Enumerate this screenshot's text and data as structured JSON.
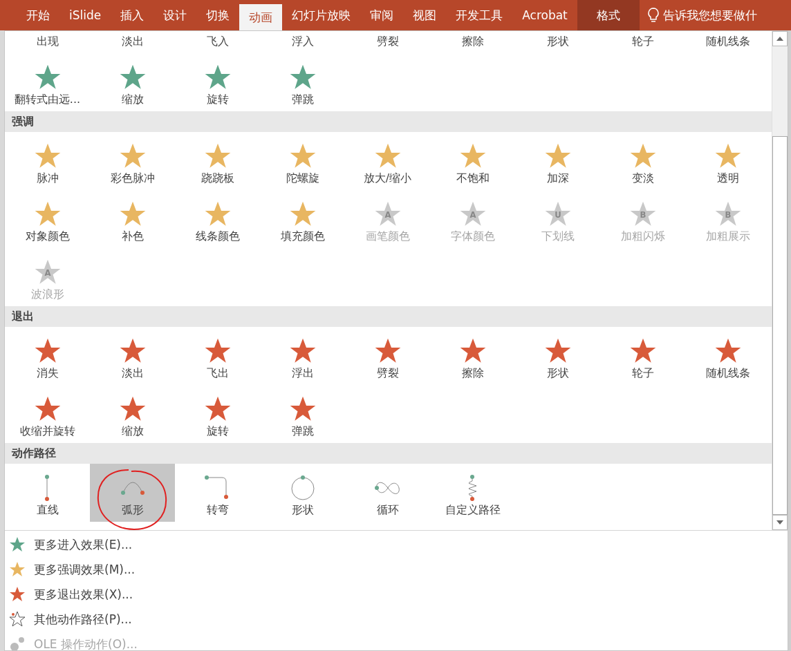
{
  "ribbon_tabs": [
    {
      "label": "开始",
      "selected": false,
      "kind": "normal"
    },
    {
      "label": "iSlide",
      "selected": false,
      "kind": "normal"
    },
    {
      "label": "插入",
      "selected": false,
      "kind": "normal"
    },
    {
      "label": "设计",
      "selected": false,
      "kind": "normal"
    },
    {
      "label": "切换",
      "selected": false,
      "kind": "normal"
    },
    {
      "label": "动画",
      "selected": true,
      "kind": "normal"
    },
    {
      "label": "幻灯片放映",
      "selected": false,
      "kind": "normal"
    },
    {
      "label": "审阅",
      "selected": false,
      "kind": "normal"
    },
    {
      "label": "视图",
      "selected": false,
      "kind": "normal"
    },
    {
      "label": "开发工具",
      "selected": false,
      "kind": "normal"
    },
    {
      "label": "Acrobat",
      "selected": false,
      "kind": "normal"
    },
    {
      "label": "格式",
      "selected": false,
      "kind": "contextual"
    }
  ],
  "tell_me": {
    "text": "告诉我您想要做什"
  },
  "sections": [
    {
      "kind": "entrance",
      "items": [
        {
          "label": "出现",
          "clipped": true,
          "disabled": false,
          "selected": false
        },
        {
          "label": "淡出",
          "clipped": true,
          "disabled": false,
          "selected": false
        },
        {
          "label": "飞入",
          "clipped": true,
          "disabled": false,
          "selected": false
        },
        {
          "label": "浮入",
          "clipped": true,
          "disabled": false,
          "selected": false
        },
        {
          "label": "劈裂",
          "clipped": true,
          "disabled": false,
          "selected": false
        },
        {
          "label": "擦除",
          "clipped": true,
          "disabled": false,
          "selected": false
        },
        {
          "label": "形状",
          "clipped": true,
          "disabled": false,
          "selected": false
        },
        {
          "label": "轮子",
          "clipped": true,
          "disabled": false,
          "selected": false
        },
        {
          "label": "随机线条",
          "clipped": true,
          "disabled": false,
          "selected": false
        },
        {
          "label": "翻转式由远...",
          "clipped": false,
          "disabled": false,
          "selected": false
        },
        {
          "label": "缩放",
          "clipped": false,
          "disabled": false,
          "selected": false
        },
        {
          "label": "旋转",
          "clipped": false,
          "disabled": false,
          "selected": false
        },
        {
          "label": "弹跳",
          "clipped": false,
          "disabled": false,
          "selected": false
        }
      ]
    },
    {
      "kind": "emphasis",
      "title": "强调",
      "items": [
        {
          "label": "脉冲",
          "disabled": false,
          "selected": false
        },
        {
          "label": "彩色脉冲",
          "disabled": false,
          "selected": false
        },
        {
          "label": "跷跷板",
          "disabled": false,
          "selected": false
        },
        {
          "label": "陀螺旋",
          "disabled": false,
          "selected": false
        },
        {
          "label": "放大/缩小",
          "disabled": false,
          "selected": false
        },
        {
          "label": "不饱和",
          "disabled": false,
          "selected": false
        },
        {
          "label": "加深",
          "disabled": false,
          "selected": false
        },
        {
          "label": "变淡",
          "disabled": false,
          "selected": false
        },
        {
          "label": "透明",
          "disabled": false,
          "selected": false
        },
        {
          "label": "对象颜色",
          "disabled": false,
          "selected": false
        },
        {
          "label": "补色",
          "disabled": false,
          "selected": false
        },
        {
          "label": "线条颜色",
          "disabled": false,
          "selected": false
        },
        {
          "label": "填充颜色",
          "disabled": false,
          "selected": false
        },
        {
          "label": "画笔颜色",
          "icon_letter": "A",
          "disabled": true,
          "selected": false
        },
        {
          "label": "字体颜色",
          "icon_letter": "A",
          "disabled": true,
          "selected": false
        },
        {
          "label": "下划线",
          "icon_letter": "U",
          "disabled": true,
          "selected": false
        },
        {
          "label": "加粗闪烁",
          "icon_letter": "B",
          "disabled": true,
          "selected": false
        },
        {
          "label": "加粗展示",
          "icon_letter": "B",
          "disabled": true,
          "selected": false
        },
        {
          "label": "波浪形",
          "icon_letter": "A",
          "disabled": true,
          "selected": false
        }
      ]
    },
    {
      "kind": "exit",
      "title": "退出",
      "items": [
        {
          "label": "消失",
          "disabled": false,
          "selected": false
        },
        {
          "label": "淡出",
          "disabled": false,
          "selected": false
        },
        {
          "label": "飞出",
          "disabled": false,
          "selected": false
        },
        {
          "label": "浮出",
          "disabled": false,
          "selected": false
        },
        {
          "label": "劈裂",
          "disabled": false,
          "selected": false
        },
        {
          "label": "擦除",
          "disabled": false,
          "selected": false
        },
        {
          "label": "形状",
          "disabled": false,
          "selected": false
        },
        {
          "label": "轮子",
          "disabled": false,
          "selected": false
        },
        {
          "label": "随机线条",
          "disabled": false,
          "selected": false
        },
        {
          "label": "收缩并旋转",
          "disabled": false,
          "selected": false
        },
        {
          "label": "缩放",
          "disabled": false,
          "selected": false
        },
        {
          "label": "旋转",
          "disabled": false,
          "selected": false
        },
        {
          "label": "弹跳",
          "disabled": false,
          "selected": false
        }
      ]
    },
    {
      "kind": "path",
      "title": "动作路径",
      "items": [
        {
          "label": "直线",
          "kind": "line",
          "disabled": false,
          "selected": false
        },
        {
          "label": "弧形",
          "kind": "arc",
          "disabled": false,
          "selected": true
        },
        {
          "label": "转弯",
          "kind": "turn",
          "disabled": false,
          "selected": false
        },
        {
          "label": "形状",
          "kind": "circle",
          "disabled": false,
          "selected": false
        },
        {
          "label": "循环",
          "kind": "loop",
          "disabled": false,
          "selected": false
        },
        {
          "label": "自定义路径",
          "kind": "custom",
          "disabled": false,
          "selected": false
        }
      ]
    }
  ],
  "menu_items": [
    {
      "label": "更多进入效果(E)...",
      "kind": "entrance",
      "disabled": false
    },
    {
      "label": "更多强调效果(M)...",
      "kind": "emphasis",
      "disabled": false
    },
    {
      "label": "更多退出效果(X)...",
      "kind": "exit",
      "disabled": false
    },
    {
      "label": "其他动作路径(P)...",
      "kind": "path",
      "disabled": false
    },
    {
      "label": "OLE 操作动作(O)...",
      "kind": "ole",
      "disabled": true
    }
  ]
}
